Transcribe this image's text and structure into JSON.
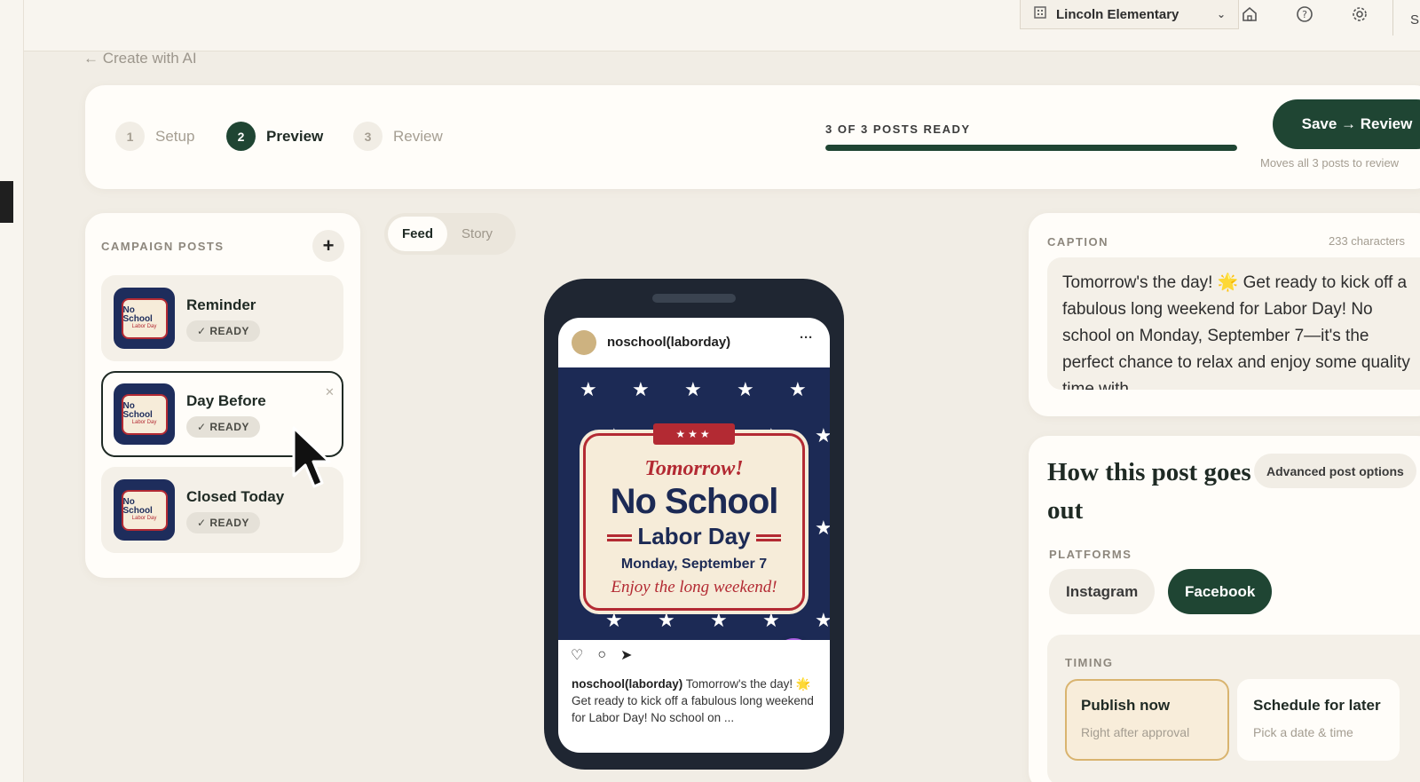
{
  "topbar": {
    "school": "Lincoln Elementary",
    "truncated_right": "S"
  },
  "back_link": "← Create with AI",
  "stepper": {
    "steps": [
      {
        "num": "1",
        "label": "Setup",
        "active": false
      },
      {
        "num": "2",
        "label": "Preview",
        "active": true
      },
      {
        "num": "3",
        "label": "Review",
        "active": false
      }
    ],
    "progress_label": "3 OF 3 POSTS READY",
    "progress_fraction": 1.0,
    "save_label": "Save → Review",
    "save_sub": "Moves all 3 posts to review"
  },
  "campaign": {
    "title": "CAMPAIGN POSTS",
    "add": "+",
    "posts": [
      {
        "title": "Reminder",
        "status": "✓ READY",
        "selected": false
      },
      {
        "title": "Day Before",
        "status": "✓ READY",
        "selected": true
      },
      {
        "title": "Closed Today",
        "status": "✓ READY",
        "selected": false
      }
    ],
    "thumb_line1": "No School",
    "thumb_line2": "Labor Day"
  },
  "tabs": {
    "feed": "Feed",
    "story": "Story",
    "active": "Feed"
  },
  "preview": {
    "username": "noschool(laborday)",
    "more": "···",
    "image": {
      "ribbon": "★★★",
      "line1": "Tomorrow!",
      "line2": "No School",
      "line3": "Labor Day",
      "line4": "Monday, September 7",
      "line5": "Enjoy the long weekend!"
    },
    "caption_user": "noschool(laborday)",
    "caption_text": " Tomorrow's the day! 🌟 Get ready to kick off a fabulous long weekend for Labor Day! No school on ..."
  },
  "caption": {
    "title": "CAPTION",
    "count": "233 characters",
    "text": "Tomorrow's the day! 🌟 Get ready to kick off a fabulous long weekend for Labor Day! No school on Monday, September 7—it's the perfect chance to relax and enjoy some quality time with"
  },
  "howto": {
    "title": "How this post goes out",
    "advanced": "Advanced post options",
    "platforms_title": "PLATFORMS",
    "platforms": [
      {
        "label": "Instagram",
        "selected": false
      },
      {
        "label": "Facebook",
        "selected": true
      }
    ],
    "timing_title": "TIMING",
    "timing": [
      {
        "title": "Publish now",
        "sub": "Right after approval",
        "selected": true
      },
      {
        "title": "Schedule for later",
        "sub": "Pick a date & time",
        "selected": false
      }
    ]
  },
  "colors": {
    "accent": "#1f4533",
    "background": "#f1ede5",
    "card": "#fffdf9",
    "selected_timing": "#f8edda",
    "edit_fab": "#a95ee0"
  },
  "icons": [
    "building-icon",
    "chevron-down-icon",
    "home-icon",
    "help-icon",
    "gear-icon",
    "plus-icon",
    "check-icon",
    "close-icon",
    "heart-icon",
    "comment-icon",
    "send-icon",
    "pencil-icon",
    "cursor-icon"
  ]
}
